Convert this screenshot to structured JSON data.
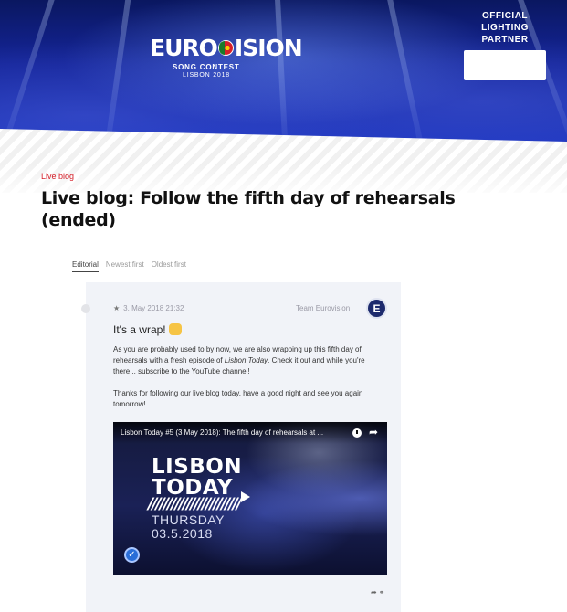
{
  "header": {
    "logo": {
      "wordmark": "EUROVISION",
      "line1": "SONG CONTEST",
      "line2": "LISBON 2018"
    },
    "partner_label": [
      "OFFICIAL",
      "LIGHTING",
      "PARTNER"
    ]
  },
  "breadcrumb": "Live blog",
  "page_title": "Live blog: Follow the fifth day of rehearsals (ended)",
  "sort_tabs": [
    {
      "label": "Editorial",
      "active": true
    },
    {
      "label": "Newest first",
      "active": false
    },
    {
      "label": "Oldest first",
      "active": false
    }
  ],
  "post": {
    "timestamp": "3. May 2018 21:32",
    "author": "Team Eurovision",
    "avatar_letter": "E",
    "title": "It's a wrap!",
    "paragraph1_before": "As you are probably used to by now, we are also wrapping up this fifth day of rehearsals with a fresh episode of ",
    "paragraph1_italic": "Lisbon Today",
    "paragraph1_after": ". Check it out and while you're there... subscribe to the YouTube channel!",
    "paragraph2": "Thanks for following our live blog today, have a good night and see you again tomorrow!",
    "video": {
      "title": "Lisbon Today #5 (3 May 2018): The fifth day of rehearsals at ...",
      "overlay_line1": "LISBON",
      "overlay_line2": "TODAY",
      "overlay_slashes": "////////////////////////",
      "overlay_day": "THURSDAY",
      "overlay_date": "03.5.2018"
    }
  },
  "colors": {
    "accent_red": "#d6202a",
    "card_bg": "#f1f3f8",
    "avatar_bg": "#1d2a6d"
  }
}
